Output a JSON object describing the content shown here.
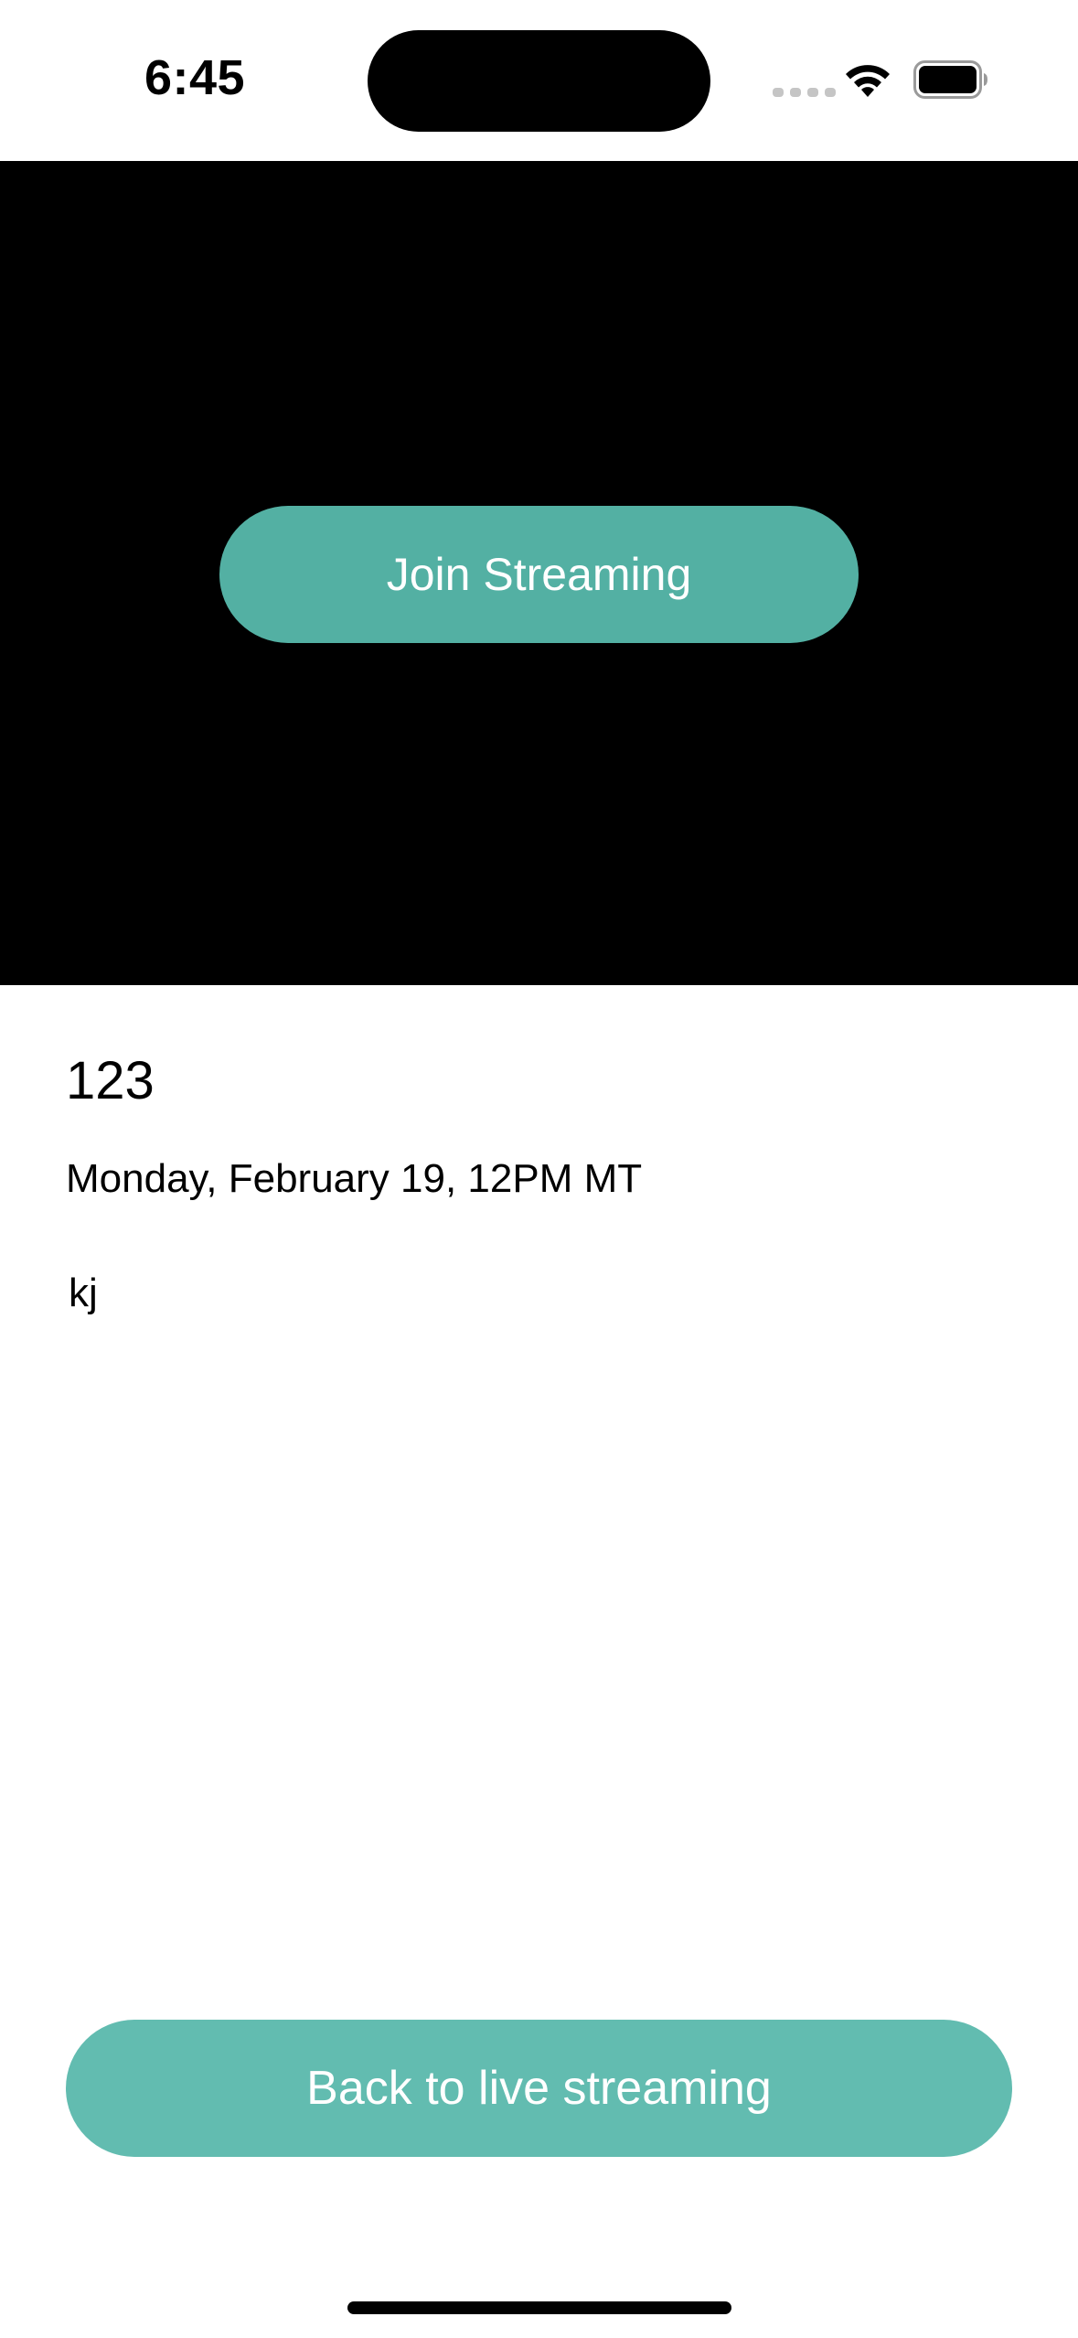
{
  "status_bar": {
    "time": "6:45"
  },
  "video": {
    "join_button_label": "Join Streaming"
  },
  "event": {
    "title": "123",
    "date": "Monday, February 19, 12PM MT",
    "description": "kj"
  },
  "footer": {
    "back_button_label": "Back to live streaming"
  },
  "colors": {
    "accent": "#53b0a3",
    "accent_light": "#62bcb0",
    "video_background": "#000000"
  },
  "icons": {
    "wifi": "wifi-icon",
    "battery": "battery-icon",
    "signal": "cellular-signal-icon"
  }
}
